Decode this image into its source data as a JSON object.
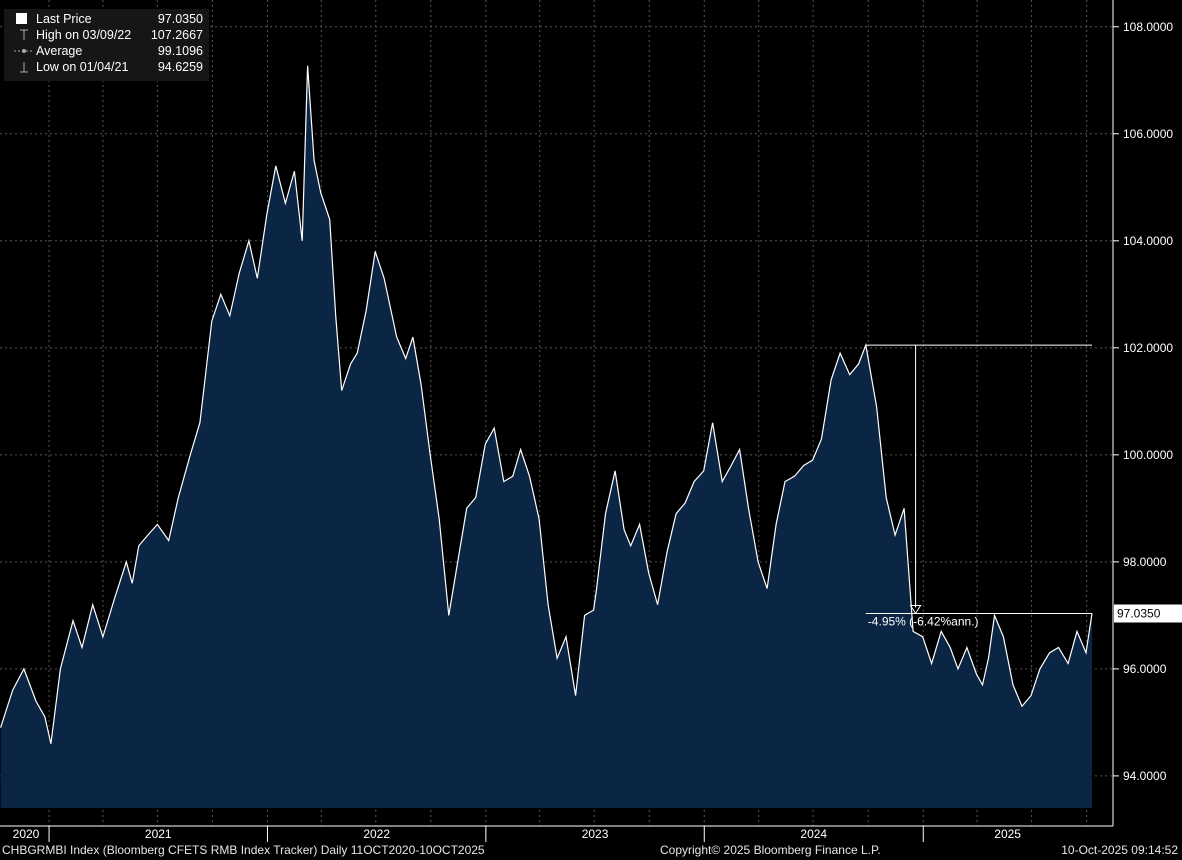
{
  "legend": {
    "last_price": {
      "label": "Last Price",
      "value": "97.0350"
    },
    "high": {
      "label": "High on 03/09/22",
      "value": "107.2667"
    },
    "average": {
      "label": "Average",
      "value": "99.1096"
    },
    "low": {
      "label": "Low on 01/04/21",
      "value": "94.6259"
    }
  },
  "footer": {
    "left": "CHBGRMBI Index (Bloomberg CFETS RMB Index Tracker) Daily 11OCT2020-10OCT2025",
    "center": "Copyright© 2025 Bloomberg Finance L.P.",
    "right": "10-Oct-2025 09:14:52"
  },
  "colors": {
    "background": "#000000",
    "area_fill": "#0b2545",
    "line": "#ffffff",
    "grid": "#555555",
    "axis_text": "#ffffff"
  },
  "chart_data": {
    "type": "area",
    "ylim": [
      93.4,
      108.5
    ],
    "y_ticks": [
      "94.0000",
      "96.0000",
      "98.0000",
      "100.0000",
      "102.0000",
      "104.0000",
      "106.0000",
      "108.0000"
    ],
    "x_range": [
      "2020-10-11",
      "2025-10-10"
    ],
    "x_year_labels": [
      "2020",
      "2021",
      "2022",
      "2023",
      "2024",
      "2025"
    ],
    "last_price_label": "97.0350",
    "annotation": {
      "text": "-4.95% (-6.42%ann.)",
      "from_date": "2024-09-27",
      "from_value": 102.05,
      "to_date": "2025-10-10",
      "to_value": 97.035
    },
    "series": [
      {
        "x": [
          "2020-10-12",
          "2020-11-01",
          "2020-11-20",
          "2020-12-10",
          "2020-12-25",
          "2021-01-04",
          "2021-01-20",
          "2021-02-10",
          "2021-02-25",
          "2021-03-15",
          "2021-04-01",
          "2021-04-20",
          "2021-05-10",
          "2021-05-20",
          "2021-05-31",
          "2021-06-15",
          "2021-07-01",
          "2021-07-20",
          "2021-08-05",
          "2021-08-25",
          "2021-09-10",
          "2021-09-30",
          "2021-10-15",
          "2021-10-30",
          "2021-11-15",
          "2021-12-01",
          "2021-12-15",
          "2021-12-31",
          "2022-01-15",
          "2022-01-31",
          "2022-02-15",
          "2022-02-28",
          "2022-03-09",
          "2022-03-20",
          "2022-03-31",
          "2022-04-15",
          "2022-04-25",
          "2022-05-05",
          "2022-05-20",
          "2022-05-31",
          "2022-06-15",
          "2022-06-30",
          "2022-07-15",
          "2022-08-05",
          "2022-08-20",
          "2022-09-01",
          "2022-09-15",
          "2022-09-30",
          "2022-10-15",
          "2022-10-31",
          "2022-11-15",
          "2022-11-30",
          "2022-12-15",
          "2022-12-31",
          "2023-01-15",
          "2023-01-31",
          "2023-02-15",
          "2023-02-28",
          "2023-03-15",
          "2023-03-31",
          "2023-04-15",
          "2023-04-30",
          "2023-05-15",
          "2023-05-31",
          "2023-06-15",
          "2023-06-30",
          "2023-07-05",
          "2023-07-20",
          "2023-08-05",
          "2023-08-20",
          "2023-08-31",
          "2023-09-15",
          "2023-09-30",
          "2023-10-15",
          "2023-10-31",
          "2023-11-15",
          "2023-11-30",
          "2023-12-15",
          "2023-12-31",
          "2024-01-15",
          "2024-01-31",
          "2024-02-15",
          "2024-02-29",
          "2024-03-15",
          "2024-03-31",
          "2024-04-15",
          "2024-04-30",
          "2024-05-15",
          "2024-05-31",
          "2024-06-15",
          "2024-06-30",
          "2024-07-15",
          "2024-07-31",
          "2024-08-15",
          "2024-08-31",
          "2024-09-15",
          "2024-09-27",
          "2024-10-15",
          "2024-10-31",
          "2024-11-15",
          "2024-11-30",
          "2024-12-15",
          "2024-12-31",
          "2025-01-15",
          "2025-01-31",
          "2025-02-15",
          "2025-02-28",
          "2025-03-15",
          "2025-03-31",
          "2025-04-10",
          "2025-04-20",
          "2025-04-30",
          "2025-05-15",
          "2025-05-31",
          "2025-06-15",
          "2025-06-30",
          "2025-07-15",
          "2025-07-31",
          "2025-08-15",
          "2025-08-31",
          "2025-09-15",
          "2025-09-30",
          "2025-10-10"
        ],
        "values": [
          94.9,
          95.6,
          96.0,
          95.4,
          95.1,
          94.6,
          96.0,
          96.9,
          96.4,
          97.2,
          96.6,
          97.3,
          98.0,
          97.6,
          98.3,
          98.5,
          98.7,
          98.4,
          99.2,
          100.0,
          100.6,
          102.5,
          103.0,
          102.6,
          103.4,
          104.0,
          103.3,
          104.5,
          105.4,
          104.7,
          105.3,
          104.0,
          107.27,
          105.5,
          104.9,
          104.4,
          102.6,
          101.2,
          101.7,
          101.9,
          102.7,
          103.8,
          103.3,
          102.2,
          101.8,
          102.2,
          101.3,
          100.0,
          98.8,
          97.0,
          98.0,
          99.0,
          99.2,
          100.2,
          100.5,
          99.5,
          99.6,
          100.1,
          99.6,
          98.8,
          97.2,
          96.2,
          96.6,
          95.5,
          97.0,
          97.1,
          97.5,
          98.9,
          99.7,
          98.6,
          98.3,
          98.7,
          97.8,
          97.2,
          98.2,
          98.9,
          99.1,
          99.5,
          99.7,
          100.6,
          99.5,
          99.8,
          100.1,
          99.0,
          98.0,
          97.5,
          98.7,
          99.5,
          99.6,
          99.8,
          99.9,
          100.3,
          101.4,
          101.9,
          101.5,
          101.7,
          102.05,
          100.9,
          99.2,
          98.5,
          99.0,
          96.7,
          96.6,
          96.1,
          96.7,
          96.4,
          96.0,
          96.4,
          95.9,
          95.7,
          96.2,
          97.0,
          96.6,
          95.7,
          95.3,
          95.5,
          96.0,
          96.3,
          96.4,
          96.1,
          96.7,
          96.3,
          97.035
        ]
      }
    ]
  }
}
